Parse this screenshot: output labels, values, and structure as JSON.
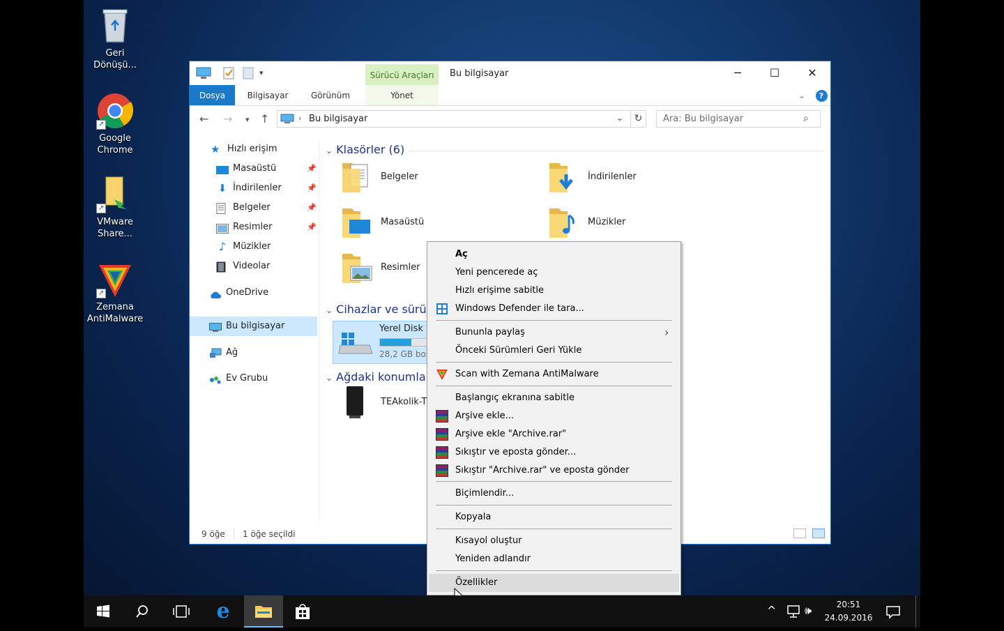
{
  "desktop": {
    "icons": [
      {
        "label": "Geri Dönüşü..."
      },
      {
        "label": "Google Chrome"
      },
      {
        "label": "VMware Share..."
      },
      {
        "label": "Zemana AntiMalware"
      }
    ]
  },
  "window": {
    "contextual_tab": "Sürücü Araçları",
    "title": "Bu bilgisayar",
    "controls": {
      "minimize": "─",
      "maximize": "☐",
      "close": "✕"
    },
    "ribbon_tabs": [
      "Dosya",
      "Bilgisayar",
      "Görünüm",
      "Yönet"
    ],
    "address": {
      "back": "←",
      "forward": "→",
      "up": "↑",
      "path": "Bu bilgisayar"
    },
    "search_placeholder": "Ara: Bu bilgisayar",
    "nav": {
      "quick_access": "Hızlı erişim",
      "items": [
        "Masaüstü",
        "İndirilenler",
        "Belgeler",
        "Resimler",
        "Müzikler",
        "Videolar"
      ],
      "onedrive": "OneDrive",
      "this_pc": "Bu bilgisayar",
      "network": "Ağ",
      "homegroup": "Ev Grubu"
    },
    "groups": {
      "folders": "Klasörler (6)",
      "devices": "Cihazlar ve sürüc",
      "network": "Ağdaki konumla"
    },
    "folders": [
      "Belgeler",
      "İndirilenler",
      "Masaüstü",
      "Müzikler",
      "Resimler"
    ],
    "disk": {
      "name": "Yerel Disk (",
      "free": "28,2 GB boş",
      "used_fraction": 0.62
    },
    "network_location": "TEAkolik-T",
    "status": {
      "count": "9 öğe",
      "selected": "1 öğe seçildi"
    }
  },
  "context_menu": {
    "items": [
      {
        "label": "Aç",
        "bold": true
      },
      {
        "label": "Yeni pencerede aç"
      },
      {
        "label": "Hızlı erişime sabitle"
      },
      {
        "label": "Windows Defender ile tara..."
      },
      {
        "label": "Bununla paylaş"
      },
      {
        "label": "Önceki Sürümleri Geri Yükle"
      },
      {
        "label": "Scan with Zemana AntiMalware"
      },
      {
        "label": "Başlangıç ekranına sabitle"
      },
      {
        "label": "Arşive ekle..."
      },
      {
        "label": "Arşive ekle \"Archive.rar\""
      },
      {
        "label": "Sıkıştır ve eposta gönder..."
      },
      {
        "label": "Sıkıştır \"Archive.rar\" ve eposta gönder"
      },
      {
        "label": "Biçimlendir..."
      },
      {
        "label": "Kopyala"
      },
      {
        "label": "Kısayol oluştur"
      },
      {
        "label": "Yeniden adlandır"
      },
      {
        "label": "Özellikler",
        "highlighted": true
      }
    ]
  },
  "taskbar": {
    "time": "20:51",
    "date": "24.09.2016"
  },
  "colors": {
    "accent": "#1979ca",
    "selection": "#cce8ff",
    "contextual_tab": "#d8f0c2",
    "disk_bar": "#26a0da"
  }
}
